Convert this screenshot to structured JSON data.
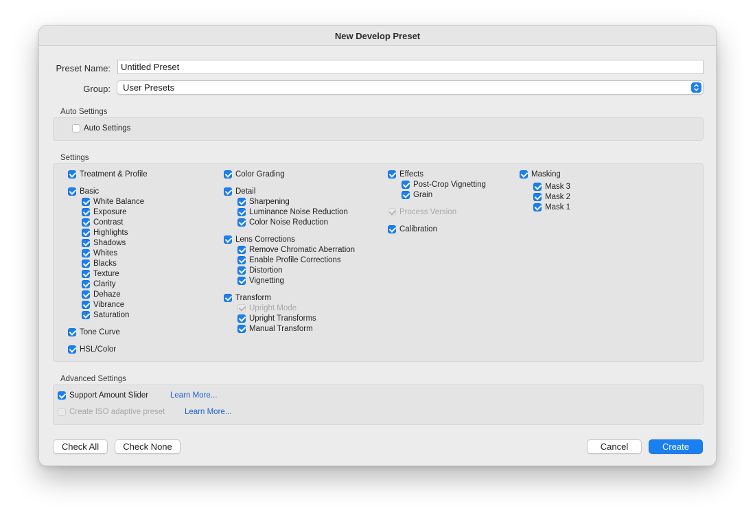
{
  "window": {
    "title": "New Develop Preset"
  },
  "form": {
    "preset_name_label": "Preset Name:",
    "preset_name_value": "Untitled Preset",
    "group_label": "Group:",
    "group_value": "User Presets"
  },
  "auto_settings": {
    "title": "Auto Settings",
    "checkbox": {
      "label": "Auto Settings",
      "checked": false
    }
  },
  "settings": {
    "title": "Settings",
    "items": {
      "treatment_profile": "Treatment & Profile",
      "basic": "Basic",
      "white_balance": "White Balance",
      "exposure": "Exposure",
      "contrast": "Contrast",
      "highlights": "Highlights",
      "shadows": "Shadows",
      "whites": "Whites",
      "blacks": "Blacks",
      "texture": "Texture",
      "clarity": "Clarity",
      "dehaze": "Dehaze",
      "vibrance": "Vibrance",
      "saturation": "Saturation",
      "tone_curve": "Tone Curve",
      "hsl_color": "HSL/Color",
      "color_grading": "Color Grading",
      "detail": "Detail",
      "sharpening": "Sharpening",
      "luminance_noise": "Luminance Noise Reduction",
      "color_noise": "Color Noise Reduction",
      "lens_corrections": "Lens Corrections",
      "remove_ca": "Remove Chromatic Aberration",
      "profile_corrections": "Enable Profile Corrections",
      "distortion": "Distortion",
      "vignetting": "Vignetting",
      "transform": "Transform",
      "upright_mode": "Upright Mode",
      "upright_transforms": "Upright Transforms",
      "manual_transform": "Manual Transform",
      "effects": "Effects",
      "post_crop_vignetting": "Post-Crop Vignetting",
      "grain": "Grain",
      "process_version": "Process Version",
      "calibration": "Calibration",
      "masking": "Masking",
      "mask3": "Mask 3",
      "mask2": "Mask 2",
      "mask1": "Mask 1"
    }
  },
  "advanced": {
    "title": "Advanced Settings",
    "support_slider": "Support Amount Slider",
    "iso_adaptive": "Create ISO adaptive preset",
    "learn_more_1": "Learn More...",
    "learn_more_2": "Learn More..."
  },
  "buttons": {
    "check_all": "Check All",
    "check_none": "Check None",
    "cancel": "Cancel",
    "create": "Create"
  },
  "colors": {
    "accent": "#1a7ff0",
    "link": "#1f5fd6"
  }
}
